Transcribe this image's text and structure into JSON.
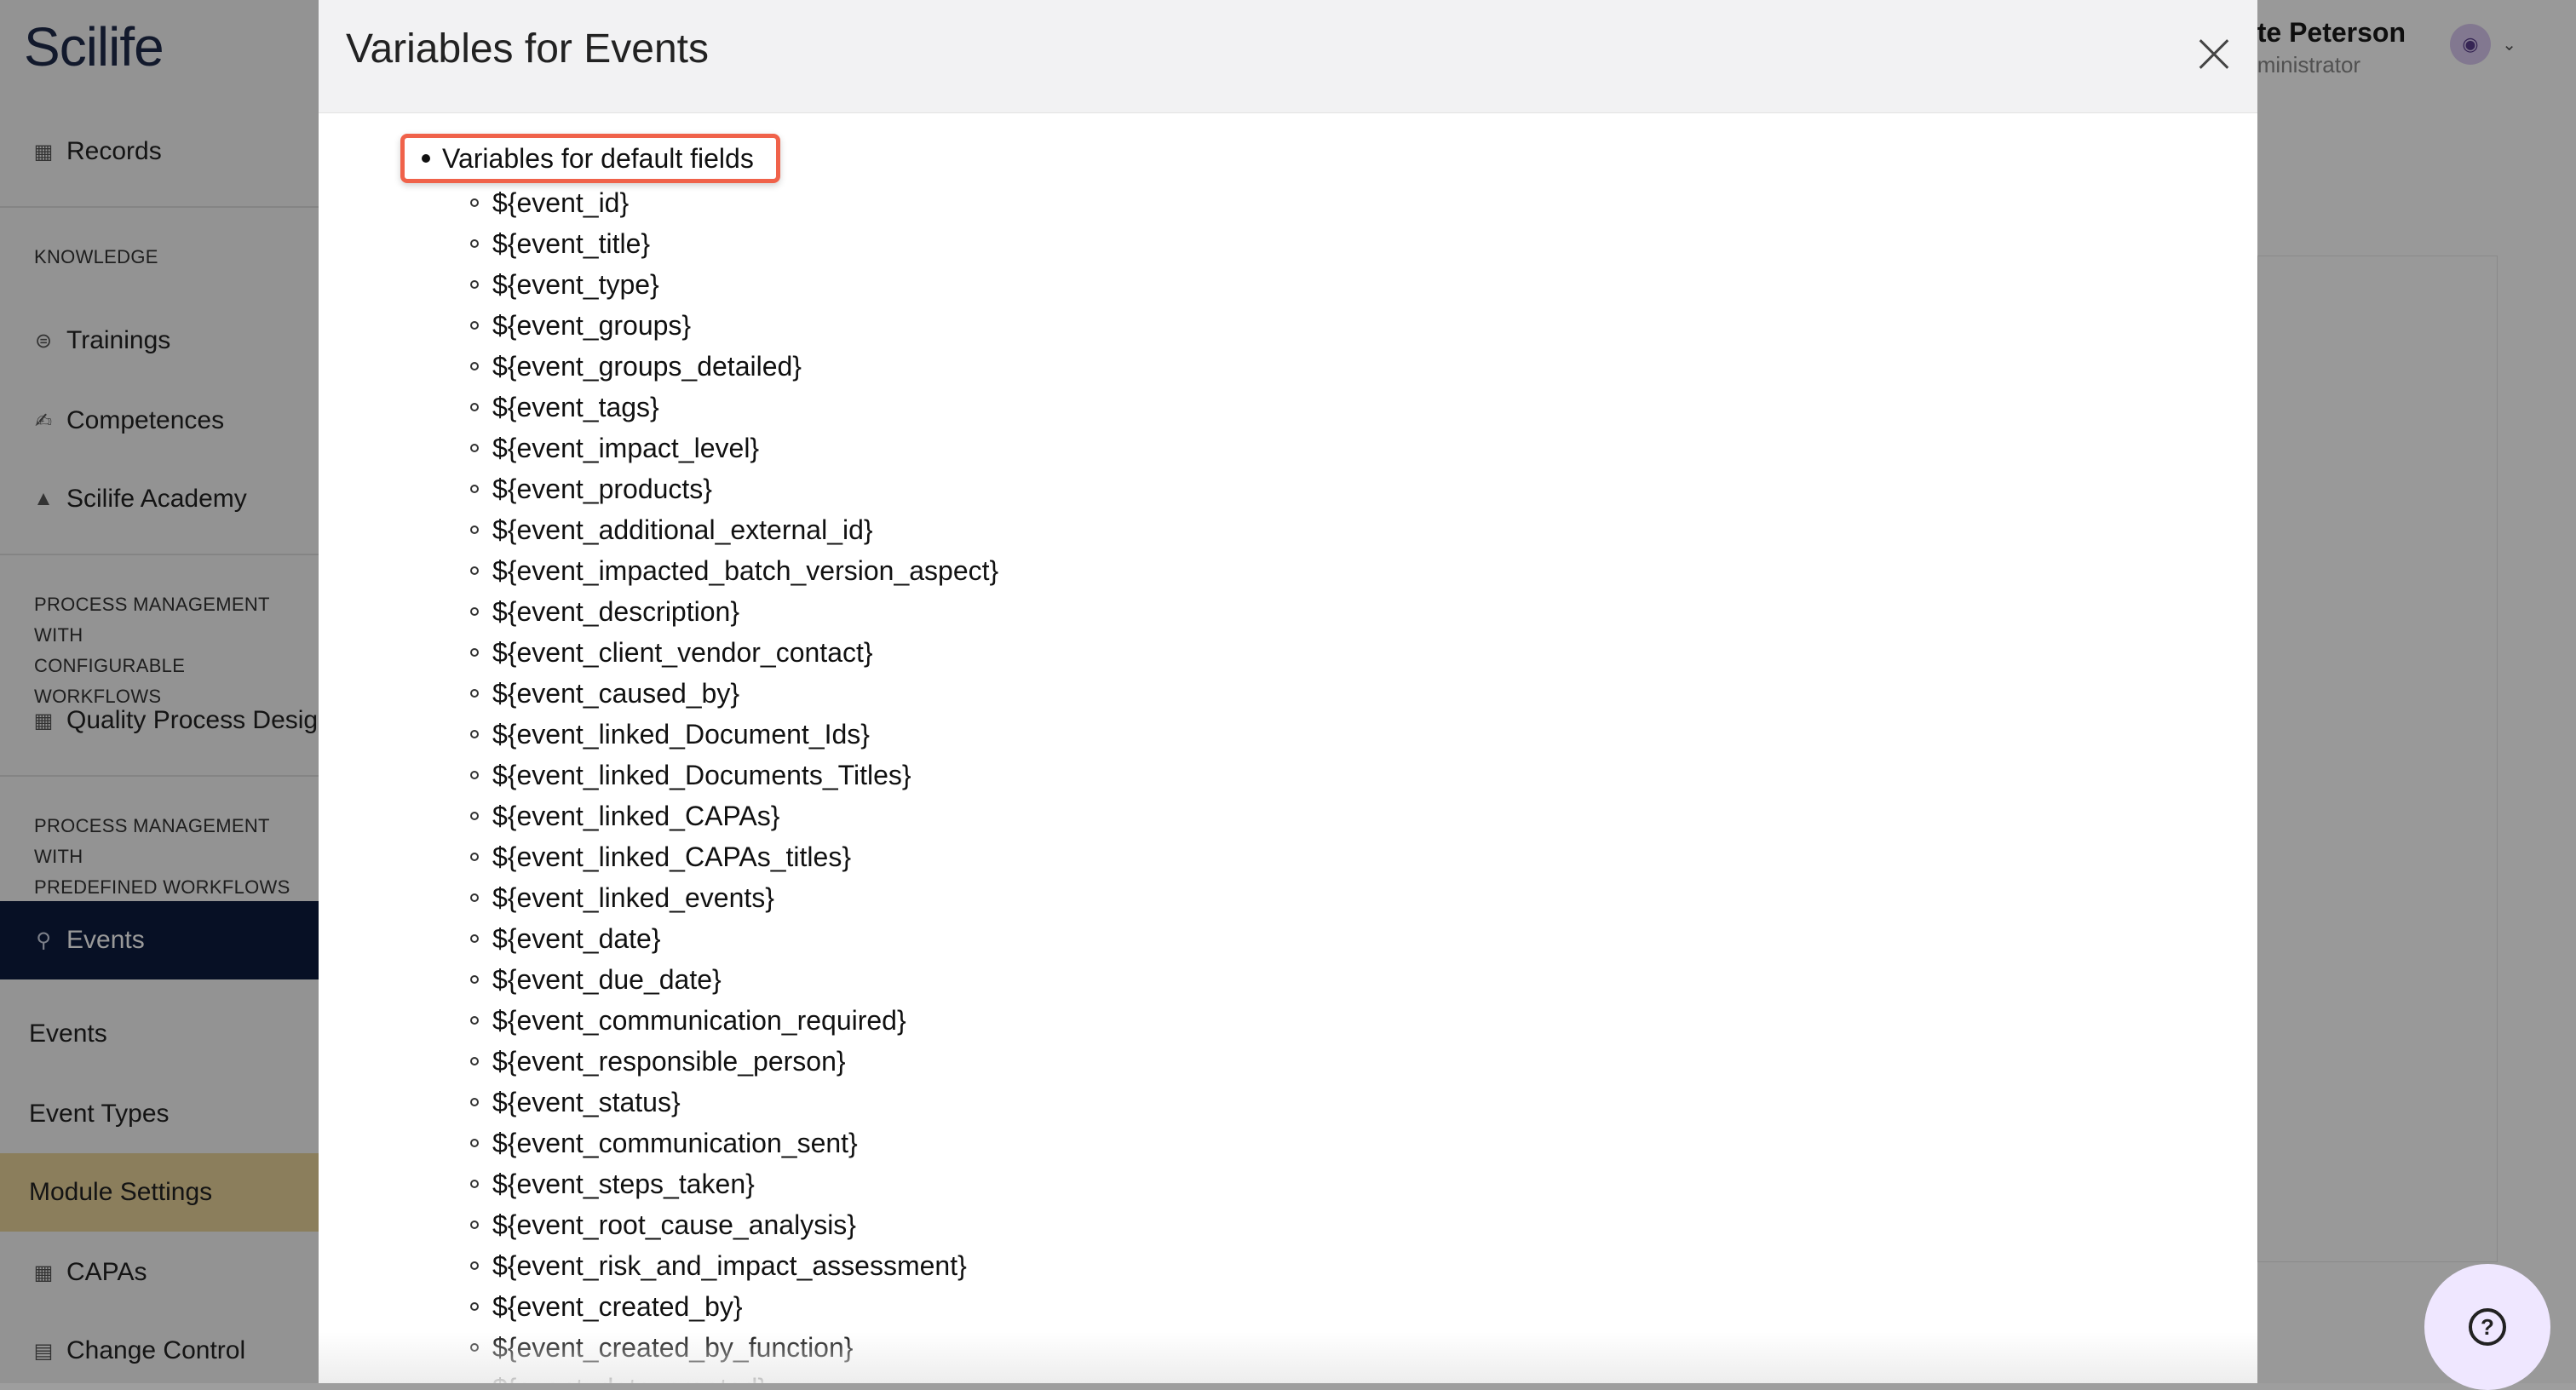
{
  "app": {
    "logo": "Scilife",
    "user": {
      "name": "te Peterson",
      "role": "ministrator"
    }
  },
  "sidebar": {
    "records": "Records",
    "knowledge_header": "KNOWLEDGE",
    "trainings": "Trainings",
    "competences": "Competences",
    "academy": "Scilife Academy",
    "configurable_header_1": "PROCESS MANAGEMENT WITH",
    "configurable_header_2": "CONFIGURABLE WORKFLOWS",
    "quality_process": "Quality Process Desig",
    "predefined_header_1": "PROCESS MANAGEMENT WITH",
    "predefined_header_2": "PREDEFINED WORKFLOWS",
    "events": "Events",
    "events_sub": "Events",
    "event_types": "Event Types",
    "module_settings": "Module Settings",
    "capas": "CAPAs",
    "change_control": "Change Control"
  },
  "modal": {
    "title": "Variables for Events",
    "top_bullet": "Variables for default fields",
    "variables": [
      "${event_id}",
      "${event_title}",
      "${event_type}",
      "${event_groups}",
      "${event_groups_detailed}",
      "${event_tags}",
      "${event_impact_level}",
      "${event_products}",
      "${event_additional_external_id}",
      "${event_impacted_batch_version_aspect}",
      "${event_description}",
      "${event_client_vendor_contact}",
      "${event_caused_by}",
      "${event_linked_Document_Ids}",
      "${event_linked_Documents_Titles}",
      "${event_linked_CAPAs}",
      "${event_linked_CAPAs_titles}",
      "${event_linked_events}",
      "${event_date}",
      "${event_due_date}",
      "${event_communication_required}",
      "${event_responsible_person}",
      "${event_status}",
      "${event_communication_sent}",
      "${event_steps_taken}",
      "${event_root_cause_analysis}",
      "${event_risk_and_impact_assessment}",
      "${event_created_by}",
      "${event_created_by_function}",
      "${event_date_created}"
    ]
  }
}
